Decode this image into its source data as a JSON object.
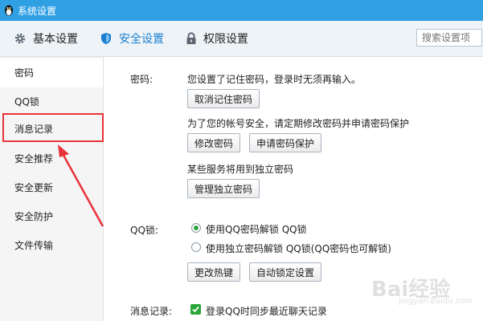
{
  "window": {
    "title": "系统设置"
  },
  "tabs": [
    {
      "label": "基本设置",
      "icon": "gear-icon"
    },
    {
      "label": "安全设置",
      "icon": "shield-icon",
      "active": true
    },
    {
      "label": "权限设置",
      "icon": "lock-icon"
    }
  ],
  "search": {
    "placeholder": "搜索设置项"
  },
  "sidebar": {
    "items": [
      {
        "label": "密码",
        "active": true
      },
      {
        "label": "QQ锁"
      },
      {
        "label": "消息记录",
        "highlighted": true
      },
      {
        "label": "安全推荐"
      },
      {
        "label": "安全更新"
      },
      {
        "label": "安全防护"
      },
      {
        "label": "文件传输"
      }
    ]
  },
  "password": {
    "label": "密码:",
    "remembered_text": "您设置了记住密码，登录时无须再输入。",
    "cancel_remember_button": "取消记住密码",
    "advice_text": "为了您的帐号安全，请定期修改密码并申请密码保护",
    "change_button": "修改密码",
    "apply_protection_button": "申请密码保护",
    "independent_text": "某些服务将用到独立密码",
    "manage_independent_button": "管理独立密码"
  },
  "qq_lock": {
    "label": "QQ锁:",
    "option_qq_password": "使用QQ密码解锁 QQ锁",
    "option_independent": "使用独立密码解锁 QQ锁(QQ密码也可解锁)",
    "selected": "option_qq_password",
    "change_hotkey_button": "更改热键",
    "auto_lock_button": "自动锁定设置"
  },
  "message_record": {
    "label": "消息记录:",
    "sync_checkbox": "登录QQ时同步最近聊天记录",
    "sync_checked": true
  },
  "watermark": {
    "brand": "Bai经验",
    "url": "jingyan.baidu.com"
  },
  "colors": {
    "titlebar": "#2fa0e4",
    "accent": "#1a7fd1",
    "highlight": "#e8333a",
    "check": "#2aa538"
  }
}
